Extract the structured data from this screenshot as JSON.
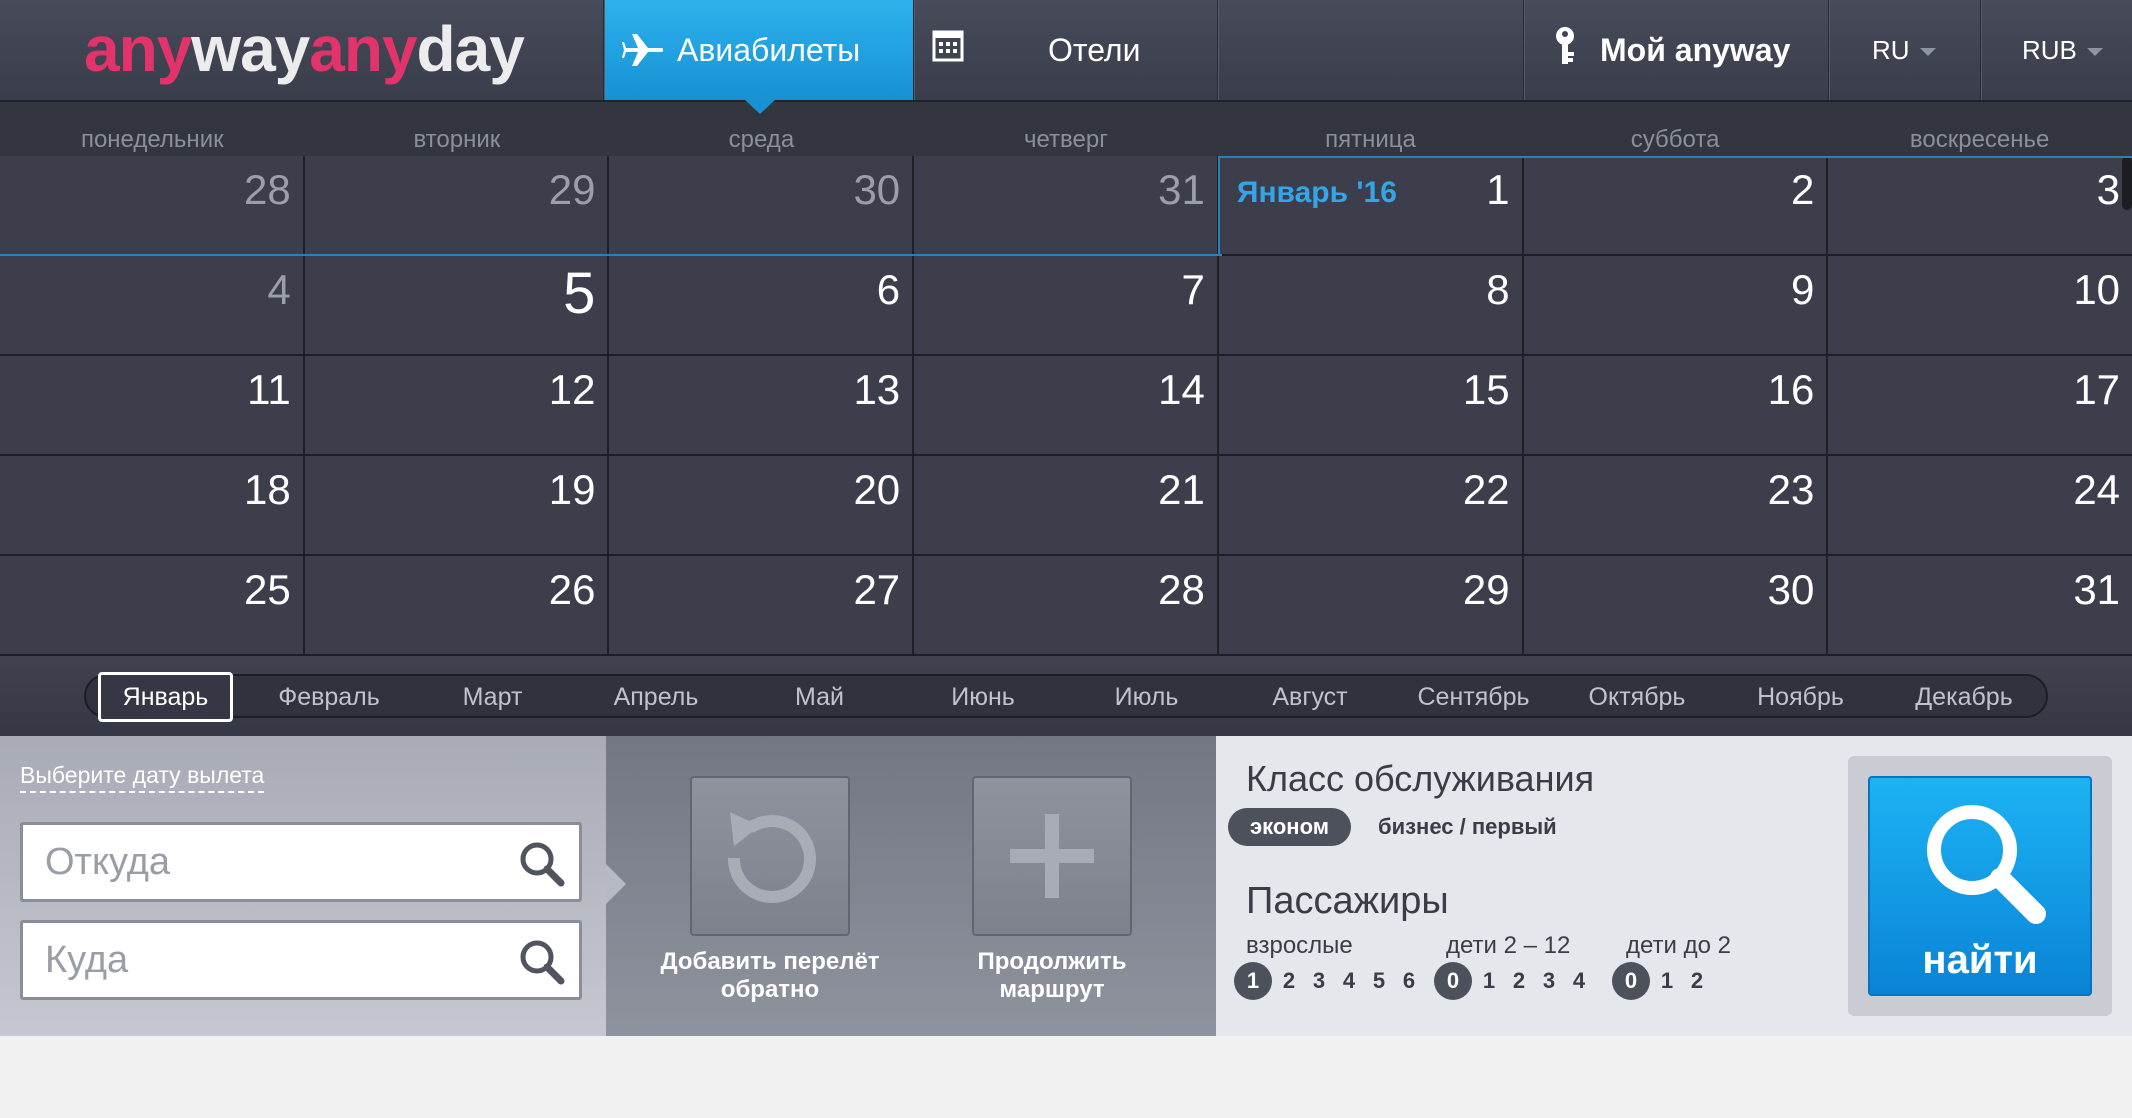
{
  "header": {
    "logo_part1": "any",
    "logo_part2": "way",
    "logo_part3": "any",
    "logo_part4": "day",
    "tab_flights": "Авиабилеты",
    "tab_hotels": "Отели",
    "my_account": "Мой anyway",
    "language": "RU",
    "currency": "RUB"
  },
  "weekdays": [
    "понедельник",
    "вторник",
    "среда",
    "четверг",
    "пятница",
    "суббота",
    "воскресенье"
  ],
  "calendar": {
    "month_label": "Январь '16",
    "weeks": [
      [
        "28",
        "29",
        "30",
        "31",
        "1",
        "2",
        "3"
      ],
      [
        "4",
        "5",
        "6",
        "7",
        "8",
        "9",
        "10"
      ],
      [
        "11",
        "12",
        "13",
        "14",
        "15",
        "16",
        "17"
      ],
      [
        "18",
        "19",
        "20",
        "21",
        "22",
        "23",
        "24"
      ],
      [
        "25",
        "26",
        "27",
        "28",
        "29",
        "30",
        "31"
      ]
    ]
  },
  "months": [
    "Январь",
    "Февраль",
    "Март",
    "Апрель",
    "Май",
    "Июнь",
    "Июль",
    "Август",
    "Сентябрь",
    "Октябрь",
    "Ноябрь",
    "Декабрь"
  ],
  "form": {
    "date_hint": "Выберите дату вылета",
    "from_placeholder": "Откуда",
    "to_placeholder": "Куда",
    "add_return": "Добавить перелёт обратно",
    "continue_route": "Продолжить маршрут"
  },
  "service_class": {
    "title": "Класс обслуживания",
    "economy": "эконом",
    "business": "бизнес / первый"
  },
  "passengers": {
    "title": "Пассажиры",
    "adults_label": "взрослые",
    "children_label": "дети 2 – 12",
    "infants_label": "дети до 2",
    "adults": [
      "1",
      "2",
      "3",
      "4",
      "5",
      "6"
    ],
    "children": [
      "0",
      "1",
      "2",
      "3",
      "4"
    ],
    "infants": [
      "0",
      "1",
      "2"
    ]
  },
  "search": {
    "label": "найти"
  },
  "colors": {
    "accent_blue": "#1ba3e6",
    "logo_pink": "#e2336b"
  }
}
